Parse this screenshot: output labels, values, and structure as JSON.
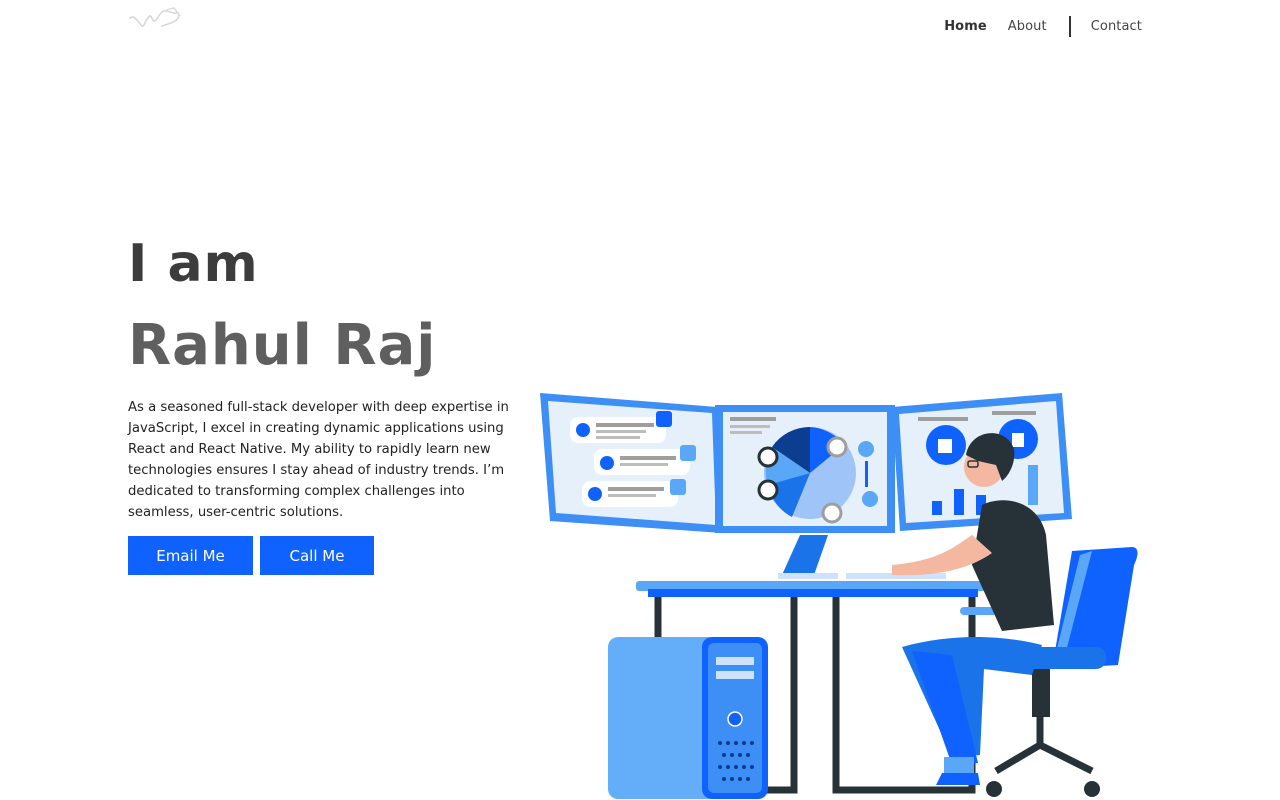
{
  "header": {
    "logo_icon": "signature-logo-icon",
    "nav": {
      "home": "Home",
      "about": "About",
      "contact": "Contact"
    }
  },
  "hero": {
    "intro": "I am",
    "name": "Rahul Raj",
    "description": "As a seasoned full-stack developer with deep expertise in JavaScript, I excel in creating dynamic applications using React and React Native. My ability to rapidly learn new technologies ensures I stay ahead of industry trends. I’m dedicated to transforming complex challenges into seamless, user-centric solutions.",
    "buttons": {
      "email": "Email Me",
      "call": "Call Me"
    }
  },
  "illustration": {
    "icon": "developer-at-workstation-illustration",
    "colors": {
      "primary": "#0f62fe",
      "light_blue": "#5aa7f7",
      "screen_bg": "#e6f0fb",
      "dark": "#263238"
    }
  }
}
